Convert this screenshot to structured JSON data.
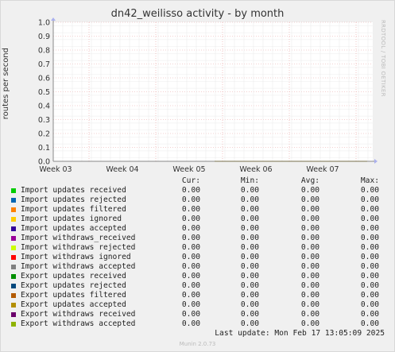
{
  "title": "dn42_weilisso activity - by month",
  "side_label": "RRDTOOL / TOBI OETIKER",
  "footer": "Munin 2.0.73",
  "last_update": "Last update: Mon Feb 17 13:05:09 2025",
  "legend_headers": [
    "Cur:",
    "Min:",
    "Avg:",
    "Max:"
  ],
  "chart_data": {
    "type": "line",
    "title": "dn42_weilisso activity - by month",
    "xlabel": "",
    "ylabel": "routes per second",
    "ylim": [
      0,
      1.0
    ],
    "y_ticks": [
      "0.0",
      "0.1",
      "0.2",
      "0.3",
      "0.4",
      "0.5",
      "0.6",
      "0.7",
      "0.8",
      "0.9",
      "1.0"
    ],
    "x_ticks": [
      "Week 03",
      "Week 04",
      "Week 05",
      "Week 06",
      "Week 07"
    ],
    "grid": true,
    "series": [
      {
        "name": "Import updates received",
        "color": "#00cc00",
        "cur": "0.00",
        "min": "0.00",
        "avg": "0.00",
        "max": "0.00"
      },
      {
        "name": "Import updates rejected",
        "color": "#0066b3",
        "cur": "0.00",
        "min": "0.00",
        "avg": "0.00",
        "max": "0.00"
      },
      {
        "name": "Import updates filtered",
        "color": "#ff8000",
        "cur": "0.00",
        "min": "0.00",
        "avg": "0.00",
        "max": "0.00"
      },
      {
        "name": "Import updates ignored",
        "color": "#ffcc00",
        "cur": "0.00",
        "min": "0.00",
        "avg": "0.00",
        "max": "0.00"
      },
      {
        "name": "Import updates accepted",
        "color": "#330099",
        "cur": "0.00",
        "min": "0.00",
        "avg": "0.00",
        "max": "0.00"
      },
      {
        "name": "Import withdraws_received",
        "color": "#990099",
        "cur": "0.00",
        "min": "0.00",
        "avg": "0.00",
        "max": "0.00"
      },
      {
        "name": "Import withdraws rejected",
        "color": "#ccff00",
        "cur": "0.00",
        "min": "0.00",
        "avg": "0.00",
        "max": "0.00"
      },
      {
        "name": "Import withdraws ignored",
        "color": "#ff0000",
        "cur": "0.00",
        "min": "0.00",
        "avg": "0.00",
        "max": "0.00"
      },
      {
        "name": "Import withdraws accepted",
        "color": "#808080",
        "cur": "0.00",
        "min": "0.00",
        "avg": "0.00",
        "max": "0.00"
      },
      {
        "name": "Export updates received",
        "color": "#008f00",
        "cur": "0.00",
        "min": "0.00",
        "avg": "0.00",
        "max": "0.00"
      },
      {
        "name": "Export updates rejected",
        "color": "#00487d",
        "cur": "0.00",
        "min": "0.00",
        "avg": "0.00",
        "max": "0.00"
      },
      {
        "name": "Export updates filtered",
        "color": "#b35a00",
        "cur": "0.00",
        "min": "0.00",
        "avg": "0.00",
        "max": "0.00"
      },
      {
        "name": "Export updates accepted",
        "color": "#b38f00",
        "cur": "0.00",
        "min": "0.00",
        "avg": "0.00",
        "max": "0.00"
      },
      {
        "name": "Export withdraws received",
        "color": "#6b006b",
        "cur": "0.00",
        "min": "0.00",
        "avg": "0.00",
        "max": "0.00"
      },
      {
        "name": "Export withdraws accepted",
        "color": "#8fb300",
        "cur": "0.00",
        "min": "0.00",
        "avg": "0.00",
        "max": "0.00"
      }
    ]
  }
}
